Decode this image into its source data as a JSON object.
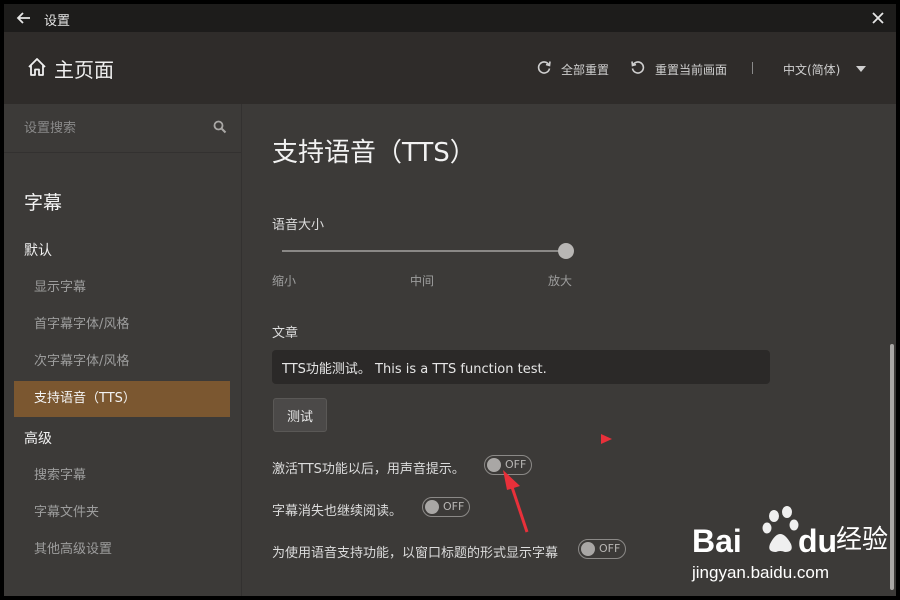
{
  "window": {
    "title": "设置"
  },
  "header": {
    "home_label": "主页面",
    "reset_all": "全部重置",
    "reset_current": "重置当前画面",
    "separator": "|",
    "language": "中文(简体)"
  },
  "sidebar": {
    "search_placeholder": "设置搜索",
    "section_title": "字幕",
    "groups": [
      {
        "label": "默认",
        "items": [
          "显示字幕",
          "首字幕字体/风格",
          "次字幕字体/风格",
          "支持语音（TTS）"
        ]
      },
      {
        "label": "高级",
        "items": [
          "搜索字幕",
          "字幕文件夹",
          "其他高级设置"
        ]
      }
    ],
    "active_item": "支持语音（TTS）"
  },
  "content": {
    "title": "支持语音（TTS）",
    "volume_label": "语音大小",
    "volume_value": 100,
    "ticks": [
      "缩小",
      "中间",
      "放大"
    ],
    "article_label": "文章",
    "article_value": "TTS功能测试。 This is a TTS function test.",
    "test_button": "测试",
    "options": [
      {
        "label": "激活TTS功能以后，用声音提示。",
        "state": "OFF"
      },
      {
        "label": "字幕消失也继续阅读。",
        "state": "OFF"
      },
      {
        "label": "为使用语音支持功能，以窗口标题的形式显示字幕",
        "state": "OFF"
      }
    ]
  },
  "watermark": {
    "brand": "Bai",
    "brand2": "du",
    "cn": "经验",
    "url": "jingyan.baidu.com"
  },
  "colors": {
    "accent": "#7b5730",
    "annotation": "#e8303a"
  }
}
